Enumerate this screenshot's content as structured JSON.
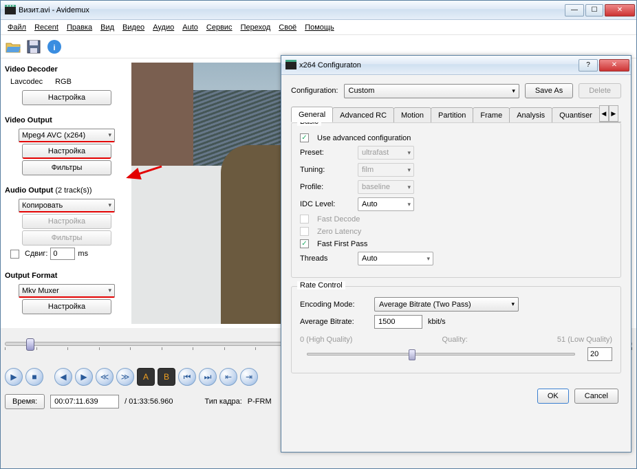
{
  "main": {
    "title": "Визит.avi - Avidemux",
    "menu": [
      "Файл",
      "Recent",
      "Правка",
      "Вид",
      "Видео",
      "Аудио",
      "Auto",
      "Сервис",
      "Переход",
      "Своё",
      "Помощь"
    ],
    "decoder": {
      "heading": "Video Decoder",
      "c1": "Lavcodec",
      "c2": "RGB",
      "btn": "Настройка"
    },
    "video_out": {
      "heading": "Video Output",
      "codec": "Mpeg4 AVC (x264)",
      "btn1": "Настройка",
      "btn2": "Фильтры"
    },
    "audio_out": {
      "heading": "Audio Output",
      "tracks": "(2 track(s))",
      "codec": "Копировать",
      "btn1": "Настройка",
      "btn2": "Фильтры",
      "shift": "Сдвиг:",
      "shift_val": "0",
      "shift_unit": "ms"
    },
    "outfmt": {
      "heading": "Output Format",
      "muxer": "Mkv Muxer",
      "btn": "Настройка"
    },
    "status": {
      "time_label": "Время:",
      "time": "00:07:11.639",
      "dur": "/ 01:33:56.960",
      "frametype_label": "Тип кадра:",
      "frametype": "P-FRM"
    }
  },
  "dialog": {
    "title": "x264 Configuraton",
    "cfg_label": "Configuration:",
    "cfg_value": "Custom",
    "saveas": "Save As",
    "delete": "Delete",
    "tabs": [
      "General",
      "Advanced RC",
      "Motion",
      "Partition",
      "Frame",
      "Analysis",
      "Quantiser"
    ],
    "basic": {
      "title": "Basic",
      "adv": "Use advanced configuration",
      "preset_l": "Preset:",
      "preset": "ultrafast",
      "tuning_l": "Tuning:",
      "tuning": "film",
      "profile_l": "Profile:",
      "profile": "baseline",
      "idc_l": "IDC Level:",
      "idc": "Auto",
      "fastdec": "Fast Decode",
      "zerolat": "Zero Latency",
      "ffp": "Fast First Pass",
      "threads_l": "Threads",
      "threads": "Auto"
    },
    "rc": {
      "title": "Rate Control",
      "mode_l": "Encoding Mode:",
      "mode": "Average Bitrate (Two Pass)",
      "br_l": "Average Bitrate:",
      "br": "1500",
      "br_unit": "kbit/s",
      "q_left": "0 (High Quality)",
      "q_mid": "Quality:",
      "q_right": "51 (Low Quality)",
      "q_val": "20"
    },
    "ok": "OK",
    "cancel": "Cancel"
  }
}
